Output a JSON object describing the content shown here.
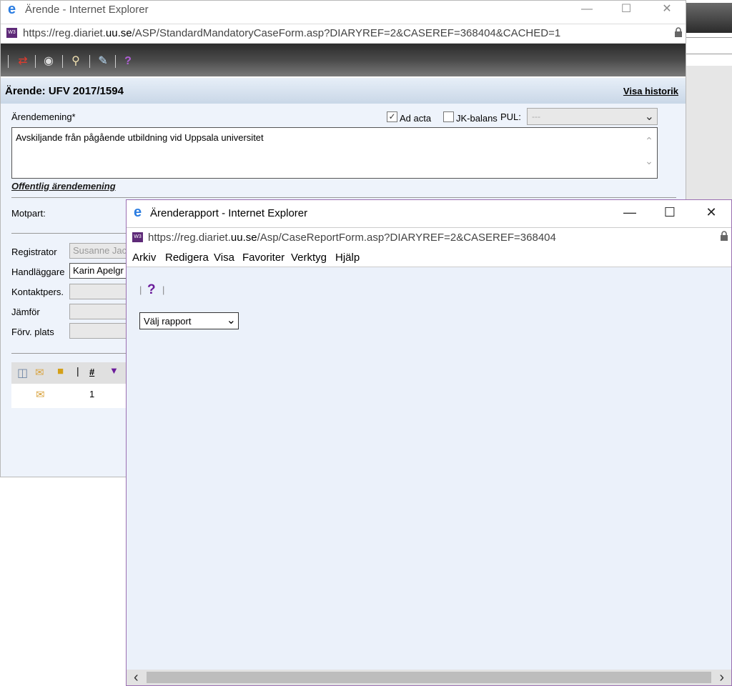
{
  "window1": {
    "title": "Ärende - Internet Explorer",
    "url_prefix": "https://reg.diariet.",
    "url_domain": "uu.se",
    "url_rest": "/ASP/StandardMandatoryCaseForm.asp?DIARYREF=2&CASEREF=368404&CACHED=1",
    "heading": "Ärende: UFV 2017/1594",
    "history_link": "Visa historik",
    "field_arendemening_label": "Ärendemening*",
    "ad_acta_label": "Ad acta",
    "ad_acta_checked": true,
    "jk_balans_label": "JK-balans",
    "jk_balans_checked": false,
    "pul_label": "PUL:",
    "pul_value": "---",
    "arendemening_text": "Avskiljande från pågående utbildning vid Uppsala universitet",
    "public_link": "Offentlig ärendemening",
    "motpart_label": "Motpart:",
    "registrator_label": "Registrator",
    "registrator_value": "Susanne Jacc",
    "handlaggare_label": "Handläggare",
    "handlaggare_value": "Karin Apelgr",
    "kontaktpers_label": "Kontaktpers.",
    "jamfor_label": "Jämför",
    "forv_plats_label": "Förv. plats",
    "grid_hash_header": "#",
    "grid_row_number": "1"
  },
  "window2": {
    "title": "Ärenderapport - Internet Explorer",
    "url_prefix": "https://reg.diariet.",
    "url_domain": "uu.se",
    "url_rest": "/Asp/CaseReportForm.asp?DIARYREF=2&CASEREF=368404",
    "menu": [
      "Arkiv",
      "Redigera",
      "Visa",
      "Favoriter",
      "Verktyg",
      "Hjälp"
    ],
    "report_select_value": "Välj rapport"
  },
  "colors": {
    "form_bg": "#eef3fb",
    "report_bg": "#ebf1fa",
    "window2_border": "#9b6fb2",
    "help_icon": "#6a1b9a"
  }
}
